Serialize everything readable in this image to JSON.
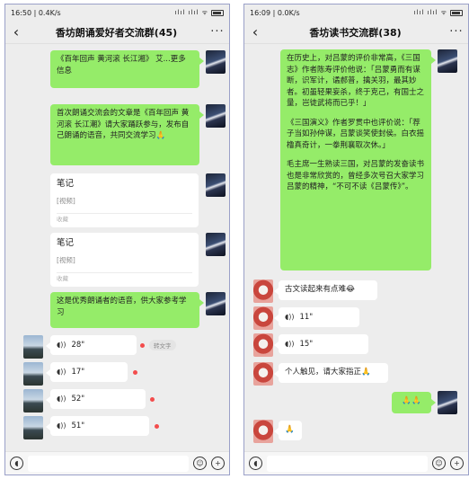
{
  "left": {
    "status": {
      "time": "16:50",
      "speed": "0.4K/s",
      "sys": "ılıl ılıl ᯤ"
    },
    "title": "香坊朗诵爱好者交流群(45)",
    "messages": [
      {
        "text": "《百年回声 黄河滚 长江湘》 艾...更多信息"
      },
      {
        "text": "首次朗诵交流会的文章是《百年回声 黄河滚 长江潮》请大家踊跃参与，发布自己朗诵的语音，共同交流学习🙏"
      },
      {
        "title": "笔记",
        "tag": "[视频]",
        "foot": "收藏"
      },
      {
        "title": "笔记",
        "tag": "[视频]",
        "foot": "收藏"
      },
      {
        "text": "这是优秀朗诵者的语音，供大家参考学习"
      }
    ],
    "voices": [
      "28\"",
      "17\"",
      "52\"",
      "51\""
    ],
    "convert_label": "转文字"
  },
  "right": {
    "status": {
      "time": "16:09",
      "speed": "0.0K/s",
      "sys": "ılıl ılıl ᯤ"
    },
    "title": "香坊读书交流群(38)",
    "long_message": {
      "p1": "在历史上，对吕蒙的评价非常高，《三国志》作者陈寿评价他说：「吕蒙勇而有谋断，识军计，谲郝普，擒关羽，最其妙者。初虽轻果妄杀，终于克己，有国士之量，岂徒武将而已乎！」",
      "p2": "《三国演义》作者罗贯中也评价说：「荐子当如孙仲谋，吕蒙谈笑使封侯。白衣摇橹真奇计，一拳荆襄取次休。」",
      "p3": "毛主席一生熟读三国，对吕蒙的发奋读书也是非常欣赏的，曾经多次号召大家学习吕蒙的精神，“不可不读《吕蒙传》”。"
    },
    "reply_text": "古文读起来有点难😂",
    "voices": [
      "11\"",
      "15\""
    ],
    "reply_text2": "个人触见，请大家指正🙏",
    "emoji_self": "🙏🙏",
    "emoji_last": "🙏"
  }
}
